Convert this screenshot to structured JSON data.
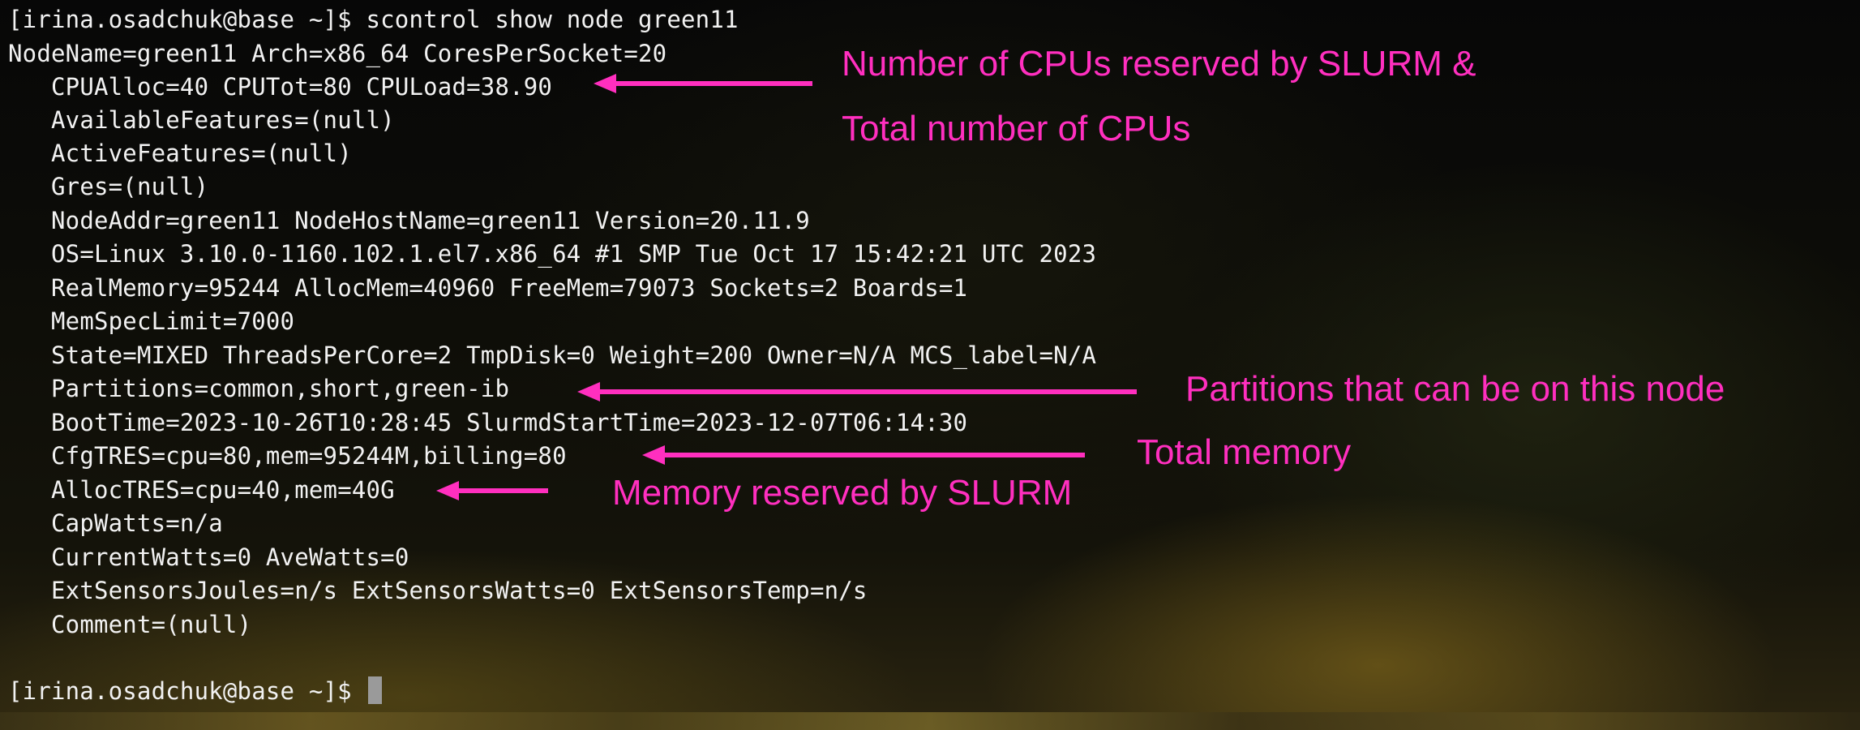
{
  "terminal": {
    "lines": [
      "[irina.osadchuk@base ~]$ scontrol show node green11",
      "NodeName=green11 Arch=x86_64 CoresPerSocket=20",
      "CPUAlloc=40 CPUTot=80 CPULoad=38.90",
      "AvailableFeatures=(null)",
      "ActiveFeatures=(null)",
      "Gres=(null)",
      "NodeAddr=green11 NodeHostName=green11 Version=20.11.9",
      "OS=Linux 3.10.0-1160.102.1.el7.x86_64 #1 SMP Tue Oct 17 15:42:21 UTC 2023",
      "RealMemory=95244 AllocMem=40960 FreeMem=79073 Sockets=2 Boards=1",
      "MemSpecLimit=7000",
      "State=MIXED ThreadsPerCore=2 TmpDisk=0 Weight=200 Owner=N/A MCS_label=N/A",
      "Partitions=common,short,green-ib",
      "BootTime=2023-10-26T10:28:45 SlurmdStartTime=2023-12-07T06:14:30",
      "CfgTRES=cpu=80,mem=95244M,billing=80",
      "AllocTRES=cpu=40,mem=40G",
      "CapWatts=n/a",
      "CurrentWatts=0 AveWatts=0",
      "ExtSensorsJoules=n/s ExtSensorsWatts=0 ExtSensorsTemp=n/s",
      "Comment=(null)"
    ],
    "prompt": "[irina.osadchuk@base ~]$ "
  },
  "annotations": {
    "cpus_line1": "Number of CPUs reserved by SLURM &",
    "cpus_line2": "Total number of CPUs",
    "partitions": "Partitions that can be on this node",
    "total_memory": "Total memory",
    "memory_reserved": "Memory reserved by SLURM"
  },
  "colors": {
    "annotation": "#ff2fbf",
    "terminal_text": "#f2f2f2"
  }
}
